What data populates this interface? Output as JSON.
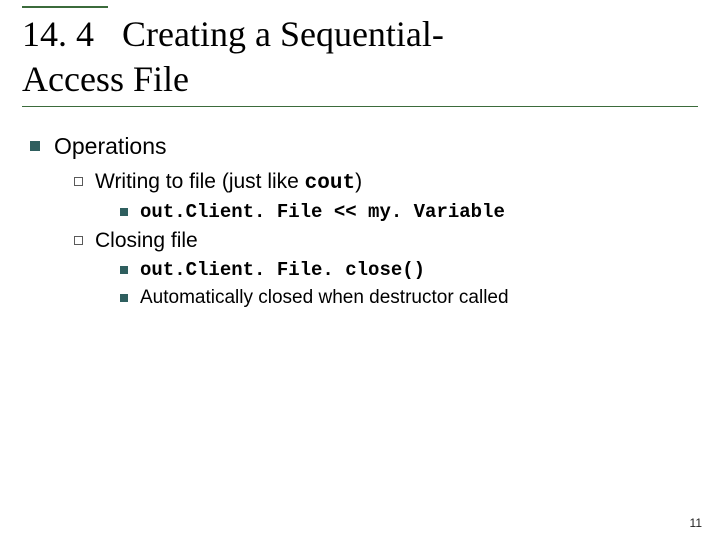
{
  "title": {
    "section": "14. 4",
    "line1": "Creating a Sequential-",
    "line2": "Access File"
  },
  "body": {
    "lvl1_0": "Operations",
    "lvl2_0": {
      "pre": "Writing to file (just like ",
      "code": "cout",
      "post": ")"
    },
    "lvl3_0": "out.Client. File << my. Variable",
    "lvl2_1": "Closing file",
    "lvl3_1": "out.Client. File. close()",
    "lvl3_2": "Automatically closed when destructor called"
  },
  "page": "11"
}
